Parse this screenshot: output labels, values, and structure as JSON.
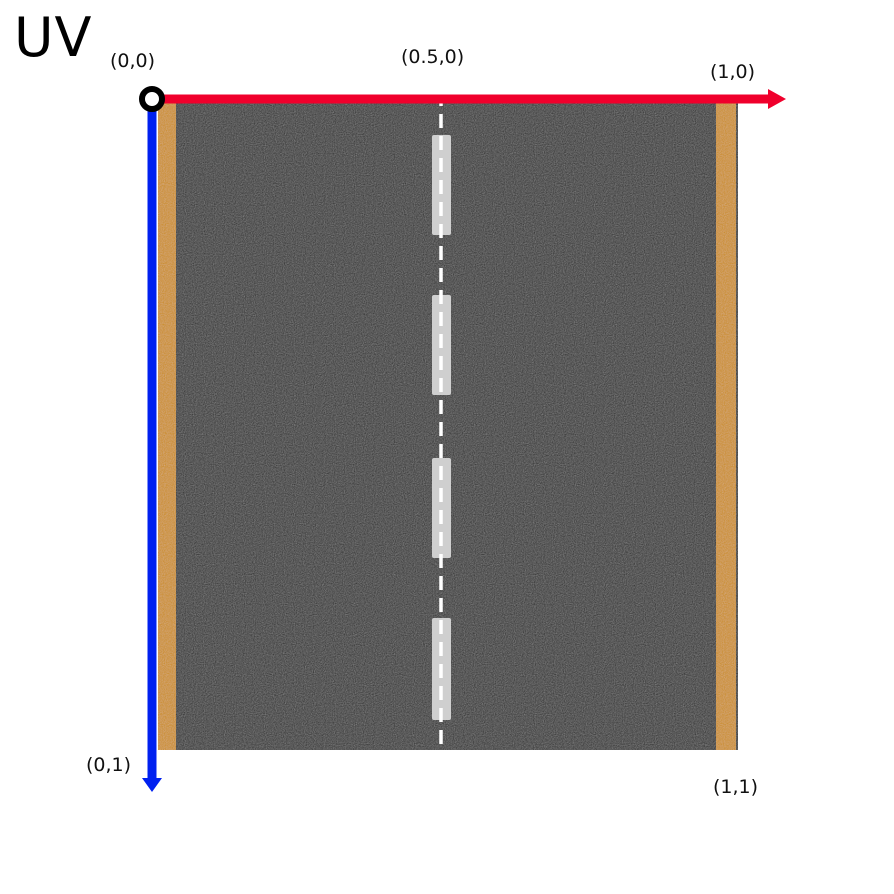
{
  "title": "UV",
  "corner_labels": {
    "origin": "(0,0)",
    "top_mid": "(0.5,0)",
    "top_right": "(1,0)",
    "bottom_left": "(0,1)",
    "bottom_right": "(1,1)"
  },
  "colors": {
    "u_axis": "#f0002c",
    "v_axis": "#0020f0",
    "asphalt": "#262626",
    "edge_line": "#c98a10",
    "lane_dash": "#cfcfcf",
    "center_guide": "#ffffff"
  },
  "icons": {
    "origin": "origin-ring-icon",
    "u_arrow": "arrow-right-icon",
    "v_arrow": "arrow-down-icon"
  }
}
